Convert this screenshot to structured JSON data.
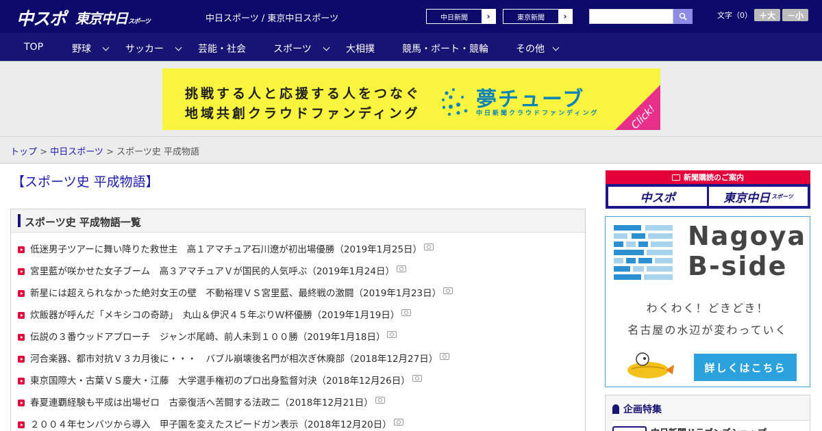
{
  "header": {
    "logo_chuspo": "中スポ",
    "logo_tokyo": "東京中日",
    "logo_tokyo_small": "スポーツ",
    "site_names": "中日スポーツ / 東京中日スポーツ",
    "btn_chunichi": "中日新聞",
    "btn_tokyo": "東京新聞",
    "search_placeholder": "",
    "fontsize_label": "文字（0）",
    "fontsize_up": "＋大",
    "fontsize_down": "－小"
  },
  "nav": {
    "items": [
      {
        "label": "TOP"
      },
      {
        "label": "野球"
      },
      {
        "label": "サッカー"
      },
      {
        "label": "芸能・社会"
      },
      {
        "label": "スポーツ"
      },
      {
        "label": "大相撲"
      },
      {
        "label": "競馬・ボート・競輪"
      },
      {
        "label": "その他"
      }
    ]
  },
  "banner": {
    "line1": "挑戦する人と応援する人をつなぐ",
    "line2": "地域共創クラウドファンディング",
    "brand": "夢チューブ",
    "brand_sub": "中日新聞クラウドファンディング",
    "click": "Click!",
    "colors": {
      "bg": "#f8f53f",
      "brand": "#0b84b8",
      "click": "#e8308a"
    }
  },
  "breadcrumb": {
    "top": "トップ",
    "sep1": " > ",
    "chunichi": "中日スポーツ",
    "sep2": " > ",
    "current": "スポーツ史 平成物語"
  },
  "page_title": "【スポーツ史 平成物語】",
  "list": {
    "title": "スポーツ史 平成物語一覧",
    "articles": [
      {
        "text": "低迷男子ツアーに舞い降りた救世主　高１アマチュア石川遼が初出場優勝（2019年1月25日）"
      },
      {
        "text": "宮里藍が咲かせた女子ブーム　高３アマチュアＶが国民的人気呼ぶ（2019年1月24日）"
      },
      {
        "text": "新星には超えられなかった絶対女王の壁　不動裕理ＶＳ宮里藍、最終戦の激闘（2019年1月23日）"
      },
      {
        "text": "炊飯器が呼んだ「メキシコの奇跡」　丸山＆伊沢４５年ぶりＷ杯優勝（2019年1月19日）"
      },
      {
        "text": "伝説の３番ウッドアプローチ　ジャンボ尾崎、前人未到１００勝（2019年1月18日）"
      },
      {
        "text": "河合楽器、都市対抗Ｖ３カ月後に・・・　バブル崩壊後名門が相次ぎ休廃部（2018年12月27日）"
      },
      {
        "text": "東京国際大・古葉ＶＳ慶大・江藤　大学選手権初のプロ出身監督対決（2018年12月26日）"
      },
      {
        "text": "春夏連覇経験も平成は出場ゼロ　古豪復活へ苦闘する法政二（2018年12月21日）"
      },
      {
        "text": "２００４年センバツから導入　甲子園を変えたスピードガン表示（2018年12月20日）"
      }
    ]
  },
  "sidebar": {
    "subscribe_head": "新聞購読のご案内",
    "sub_logo1": "中スポ",
    "sub_logo2": "東京中日",
    "sub_logo2_small": "スポーツ",
    "bside_title1": "Nagoya",
    "bside_title2": "B-side",
    "bside_sub1": "わくわく！どきどき！",
    "bside_sub2": "名古屋の水辺が変わっていく",
    "bside_btn": "詳しくはこちら",
    "feature_head": "企画特集",
    "feature_item": "中日新聞ドラゴンズショップ"
  }
}
